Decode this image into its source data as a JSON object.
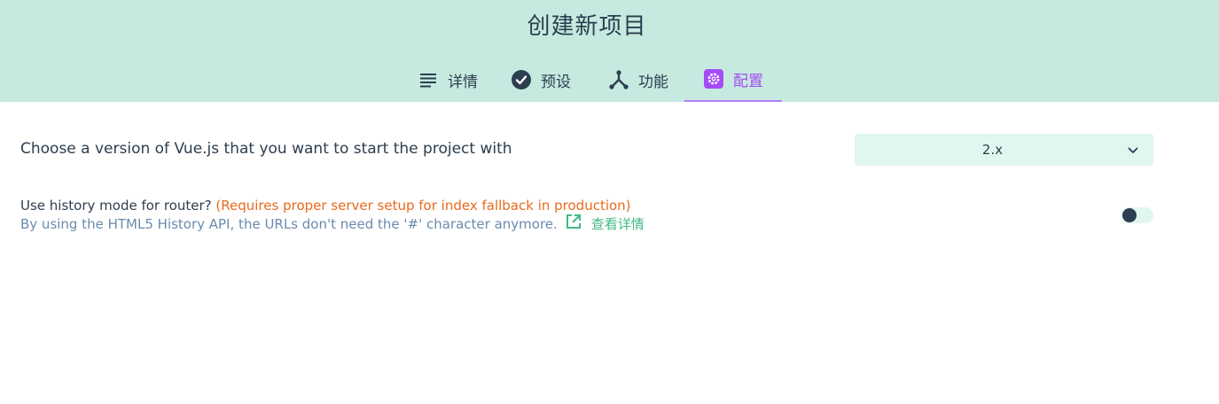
{
  "header": {
    "title": "创建新项目",
    "tabs": [
      {
        "label": "详情",
        "icon": "list-icon",
        "active": false
      },
      {
        "label": "预设",
        "icon": "check-circle-icon",
        "active": false
      },
      {
        "label": "功能",
        "icon": "fork-icon",
        "active": false
      },
      {
        "label": "配置",
        "icon": "gear-icon",
        "active": true
      }
    ]
  },
  "config": {
    "vue_version": {
      "label": "Choose a version of Vue.js that you want to start the project with",
      "selected": "2.x"
    },
    "router": {
      "label": "Use history mode for router?",
      "warning": "(Requires proper server setup for index fallback in production)",
      "description": "By using the HTML5 History API, the URLs don't need the '#' character anymore.",
      "more_link": "查看详情",
      "enabled": false
    }
  },
  "colors": {
    "header_bg": "#c6eadf",
    "accent_active": "#a44cf6",
    "warning": "#e96a1d",
    "link": "#42b983",
    "muted": "#6a8bad",
    "control_bg": "#e1f6ee"
  }
}
